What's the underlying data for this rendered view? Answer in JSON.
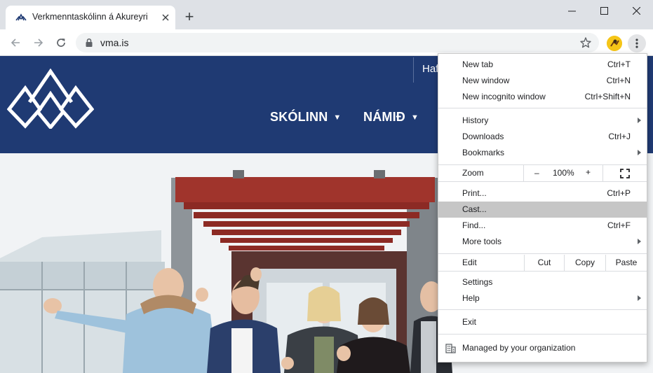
{
  "browser": {
    "tab": {
      "title": "Verkmenntaskólinn á Akureyri"
    },
    "new_tab_symbol": "+",
    "url": "vma.is",
    "icons": [
      "favicon-icon",
      "close-icon",
      "back-icon",
      "forward-icon",
      "reload-icon",
      "lock-icon",
      "star-icon",
      "extension-icon",
      "kebab-menu-icon",
      "minimize-icon",
      "maximize-icon",
      "window-close-icon"
    ]
  },
  "site": {
    "header_link": "Hafð",
    "nav": [
      {
        "label": "SKÓLINN",
        "caret": "▼"
      },
      {
        "label": "NÁMIÐ",
        "caret": "▼"
      }
    ],
    "colors": {
      "header_bg": "#1f3a73",
      "roof": "#a0342c"
    }
  },
  "menu": {
    "new_tab": {
      "label": "New tab",
      "shortcut": "Ctrl+T"
    },
    "new_window": {
      "label": "New window",
      "shortcut": "Ctrl+N"
    },
    "incognito": {
      "label": "New incognito window",
      "shortcut": "Ctrl+Shift+N"
    },
    "history": {
      "label": "History"
    },
    "downloads": {
      "label": "Downloads",
      "shortcut": "Ctrl+J"
    },
    "bookmarks": {
      "label": "Bookmarks"
    },
    "zoom": {
      "label": "Zoom",
      "minus": "–",
      "value": "100%",
      "plus": "+"
    },
    "print": {
      "label": "Print...",
      "shortcut": "Ctrl+P"
    },
    "cast": {
      "label": "Cast..."
    },
    "find": {
      "label": "Find...",
      "shortcut": "Ctrl+F"
    },
    "more_tools": {
      "label": "More tools"
    },
    "edit": {
      "label": "Edit",
      "cut": "Cut",
      "copy": "Copy",
      "paste": "Paste"
    },
    "settings": {
      "label": "Settings"
    },
    "help": {
      "label": "Help"
    },
    "exit": {
      "label": "Exit"
    },
    "managed": {
      "label": "Managed by your organization"
    }
  }
}
